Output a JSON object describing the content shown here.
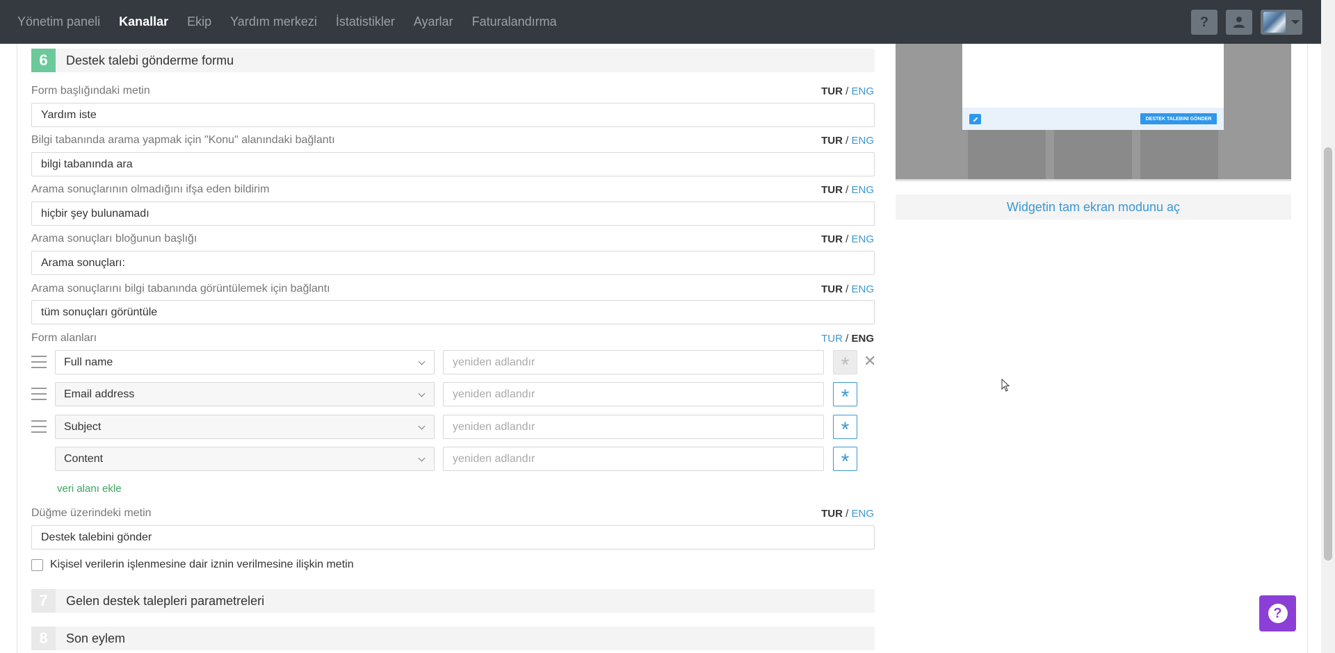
{
  "nav": {
    "items": [
      {
        "label": "Yönetim paneli",
        "active": false
      },
      {
        "label": "Kanallar",
        "active": true
      },
      {
        "label": "Ekip",
        "active": false
      },
      {
        "label": "Yardım merkezi",
        "active": false
      },
      {
        "label": "İstatistikler",
        "active": false
      },
      {
        "label": "Ayarlar",
        "active": false
      },
      {
        "label": "Faturalandırma",
        "active": false
      }
    ],
    "help_glyph": "?",
    "icons": [
      "question-icon",
      "user-icon",
      "avatar"
    ]
  },
  "step6": {
    "number": "6",
    "title": "Destek talebi gönderme formu"
  },
  "lang": {
    "tur": "TUR",
    "eng": "ENG",
    "sep": "/"
  },
  "fields": [
    {
      "label": "Form başlığındaki metin",
      "value": "Yardım iste"
    },
    {
      "label": "Bilgi tabanında arama yapmak için \"Konu\" alanındaki bağlantı",
      "value": "bilgi tabanında ara"
    },
    {
      "label": "Arama sonuçlarının olmadığını ifşa eden bildirim",
      "value": "hiçbir şey bulunamadı"
    },
    {
      "label": "Arama sonuçları bloğunun başlığı",
      "value": "Arama sonuçları:"
    },
    {
      "label": "Arama sonuçlarını bilgi tabanında görüntülemek için bağlantı",
      "value": "tüm sonuçları görüntüle"
    }
  ],
  "form_fields": {
    "label": "Form alanları",
    "rows": [
      {
        "field": "Full name",
        "rename_placeholder": "yeniden adlandır"
      },
      {
        "field": "Email address",
        "rename_placeholder": "yeniden adlandır"
      },
      {
        "field": "Subject",
        "rename_placeholder": "yeniden adlandır"
      },
      {
        "field": "Content",
        "rename_placeholder": "yeniden adlandır"
      }
    ],
    "add_link": "veri alanı ekle",
    "remove_glyph": "✕",
    "required_glyph": "*"
  },
  "button_text": {
    "label": "Düğme üzerindeki metin",
    "value": "Destek talebini gönder"
  },
  "consent_checkbox": {
    "label": "Kişisel verilerin işlenmesine dair iznin verilmesine ilişkin metin",
    "checked": false
  },
  "step7": {
    "number": "7",
    "title": "Gelen destek talepleri parametreleri"
  },
  "step8": {
    "number": "8",
    "title": "Son eylem"
  },
  "preview": {
    "send_button": "DESTEK TALEBINI GÖNDER",
    "fullscreen_link": "Widgetin tam ekran modunu aç"
  },
  "help_fab": {
    "glyph": "?"
  },
  "colors": {
    "nav_bg": "#343a40",
    "accent": "#3a97d4",
    "step_active": "#6cc99a",
    "add_link": "#3aa55d",
    "help_fab": "#8c3fd6"
  }
}
